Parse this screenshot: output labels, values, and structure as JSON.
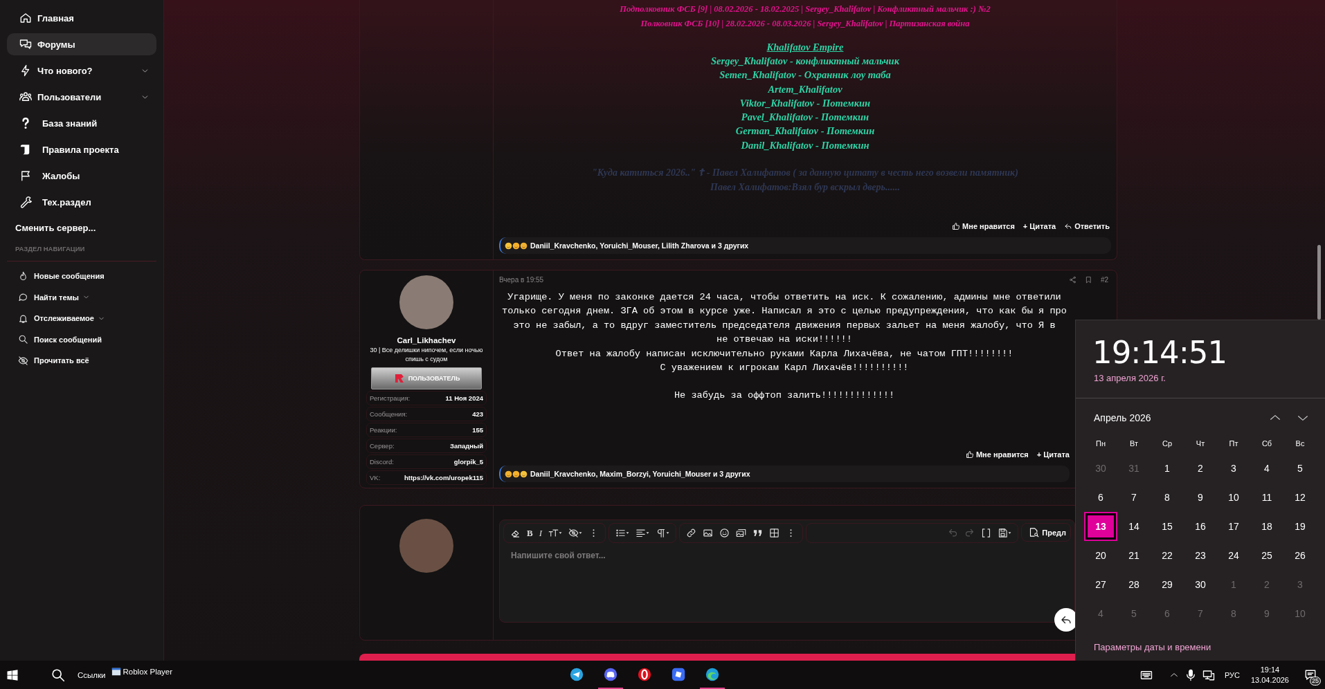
{
  "sidebar": {
    "nav": [
      {
        "label": "Главная",
        "selected": false,
        "dropdown": false
      },
      {
        "label": "Форумы",
        "selected": true,
        "dropdown": false
      },
      {
        "label": "Что нового?",
        "selected": false,
        "dropdown": true
      },
      {
        "label": "Пользователи",
        "selected": false,
        "dropdown": true
      },
      {
        "label": "База знаний",
        "selected": false,
        "dropdown": false
      },
      {
        "label": "Правила проекта",
        "selected": false,
        "dropdown": false
      },
      {
        "label": "Жалобы",
        "selected": false,
        "dropdown": false
      },
      {
        "label": "Тех.раздел",
        "selected": false,
        "dropdown": false
      }
    ],
    "server_link": "Сменить сервер...",
    "section_title": "РАЗДЕЛ НАВИГАЦИИ",
    "section_links": [
      {
        "label": "Новые сообщения",
        "dropdown": false
      },
      {
        "label": "Найти темы",
        "dropdown": true
      },
      {
        "label": "Отслеживаемое",
        "dropdown": true
      },
      {
        "label": "Поиск сообщений",
        "dropdown": false
      },
      {
        "label": "Прочитать всё",
        "dropdown": false
      }
    ]
  },
  "previous_post": {
    "lines": [
      {
        "kind": "pink",
        "text": "Подполковник ФСБ [9] | 08.02.2026 - 18.02.2025 | Sergey_Khalifatov | Конфликтный мальчик :) №2"
      },
      {
        "kind": "pink",
        "text": "Полковник ФСБ [10] | 28.02.2026 - 08.03.2026 | Sergey_Khalifatov | Партизанская война"
      },
      {
        "kind": "heading",
        "text": "Khalifatov Empire"
      },
      {
        "kind": "teal",
        "text": "Sergey_Khalifatov - конфликтный мальчик"
      },
      {
        "kind": "teal",
        "text": "Semen_Khalifatov - Охранник лоу таба"
      },
      {
        "kind": "teal",
        "text": "Artem_Khalifatov"
      },
      {
        "kind": "teal",
        "text": "Viktor_Khalifatov - Потемкин"
      },
      {
        "kind": "teal",
        "text": "Pavel_Khalifatov - Потемкин"
      },
      {
        "kind": "teal",
        "text": "German_Khalifatov - Потемкин"
      },
      {
        "kind": "teal",
        "text": "Danil_Khalifatov - Потемкин"
      },
      {
        "kind": "faded",
        "text": "\"Куда катиться 2026..\" ☦ - Павел Халифатов ( за данную цитату в честь него возвели памятник)"
      },
      {
        "kind": "faded",
        "text": "Павел Халифатов:Взял бур вскрыл дверь......"
      }
    ],
    "actions": [
      "Мне нравится",
      "+ Цитата",
      "Ответить"
    ],
    "reactions": "Daniil_Kravchenko, Yoruichi_Mouser, Lilith Zharova и 3 других"
  },
  "post": {
    "author": "Carl_Likhachev",
    "user_title": "30 | Все делишки нипочем, если ночью спишь с судом",
    "banner": "ПОЛЬЗОВАТЕЛЬ",
    "stats": [
      {
        "label": "Регистрация:",
        "value": "11 Ноя 2024"
      },
      {
        "label": "Сообщения:",
        "value": "423"
      },
      {
        "label": "Реакции:",
        "value": "155"
      },
      {
        "label": "Сервер:",
        "value": "Западный"
      },
      {
        "label": "Discord:",
        "value": "glorpik_5"
      },
      {
        "label": "VK:",
        "value": "https://vk.com/uropek115"
      }
    ],
    "date": "Вчера в 19:55",
    "number": "#2",
    "body": [
      "Угарище. У меня по законке дается 24 часа, чтобы ответить на иск. К сожалению, админы мне ответили",
      "только сегодня днем. ЗГА об этом в курсе уже. Написал я это с целью предупреждения, что как бы я про",
      "это не забыл, а то вдруг заместитель председателя движения первых зальет на меня жалобу, что Я в",
      "не отвечаю на иски!!!!!!",
      "Ответ на жалобу написан исключительно руками Карла Лихачёва, не чатом ГПТ!!!!!!!!",
      "С уважением к игрокам Карл Лихачёв!!!!!!!!!!",
      "Не забудь за оффтоп залить!!!!!!!!!!!!!"
    ],
    "actions": [
      "Мне нравится",
      "+ Цитата"
    ],
    "reactions": "Daniil_Kravchenko, Maxim_Borzyi, Yoruichi_Mouser и 3 других"
  },
  "reply_editor": {
    "bold": "B",
    "italic": "I",
    "preview": "Предл",
    "placeholder": "Напишите свой ответ..."
  },
  "calendar": {
    "time": "19:14:51",
    "date": "13 апреля 2026 г.",
    "month": "Апрель 2026",
    "weekdays": [
      "Пн",
      "Вт",
      "Ср",
      "Чт",
      "Пт",
      "Сб",
      "Вс"
    ],
    "weeks": [
      [
        {
          "day": "30",
          "muted": true,
          "selected": false
        },
        {
          "day": "31",
          "muted": true,
          "selected": false
        },
        {
          "day": "1",
          "muted": false,
          "selected": false
        },
        {
          "day": "2",
          "muted": false,
          "selected": false
        },
        {
          "day": "3",
          "muted": false,
          "selected": false
        },
        {
          "day": "4",
          "muted": false,
          "selected": false
        },
        {
          "day": "5",
          "muted": false,
          "selected": false
        }
      ],
      [
        {
          "day": "6",
          "muted": false,
          "selected": false
        },
        {
          "day": "7",
          "muted": false,
          "selected": false
        },
        {
          "day": "8",
          "muted": false,
          "selected": false
        },
        {
          "day": "9",
          "muted": false,
          "selected": false
        },
        {
          "day": "10",
          "muted": false,
          "selected": false
        },
        {
          "day": "11",
          "muted": false,
          "selected": false
        },
        {
          "day": "12",
          "muted": false,
          "selected": false
        }
      ],
      [
        {
          "day": "13",
          "muted": false,
          "selected": true
        },
        {
          "day": "14",
          "muted": false,
          "selected": false
        },
        {
          "day": "15",
          "muted": false,
          "selected": false
        },
        {
          "day": "16",
          "muted": false,
          "selected": false
        },
        {
          "day": "17",
          "muted": false,
          "selected": false
        },
        {
          "day": "18",
          "muted": false,
          "selected": false
        },
        {
          "day": "19",
          "muted": false,
          "selected": false
        }
      ],
      [
        {
          "day": "20",
          "muted": false,
          "selected": false
        },
        {
          "day": "21",
          "muted": false,
          "selected": false
        },
        {
          "day": "22",
          "muted": false,
          "selected": false
        },
        {
          "day": "23",
          "muted": false,
          "selected": false
        },
        {
          "day": "24",
          "muted": false,
          "selected": false
        },
        {
          "day": "25",
          "muted": false,
          "selected": false
        },
        {
          "day": "26",
          "muted": false,
          "selected": false
        }
      ],
      [
        {
          "day": "27",
          "muted": false,
          "selected": false
        },
        {
          "day": "28",
          "muted": false,
          "selected": false
        },
        {
          "day": "29",
          "muted": false,
          "selected": false
        },
        {
          "day": "30",
          "muted": false,
          "selected": false
        },
        {
          "day": "1",
          "muted": true,
          "selected": false
        },
        {
          "day": "2",
          "muted": true,
          "selected": false
        },
        {
          "day": "3",
          "muted": true,
          "selected": false
        }
      ],
      [
        {
          "day": "4",
          "muted": true,
          "selected": false
        },
        {
          "day": "5",
          "muted": true,
          "selected": false
        },
        {
          "day": "6",
          "muted": true,
          "selected": false
        },
        {
          "day": "7",
          "muted": true,
          "selected": false
        },
        {
          "day": "8",
          "muted": true,
          "selected": false
        },
        {
          "day": "9",
          "muted": true,
          "selected": false
        },
        {
          "day": "10",
          "muted": true,
          "selected": false
        }
      ]
    ],
    "settings_link": "Параметры даты и времени"
  },
  "taskbar": {
    "links_label": "Ссылки",
    "task": "Roblox Player",
    "apps": [
      {
        "running": false
      },
      {
        "running": true
      },
      {
        "running": false
      },
      {
        "running": false
      },
      {
        "running": true
      }
    ],
    "language": "РУС",
    "time": "19:14",
    "date": "13.04.2026",
    "notifications": "25"
  }
}
